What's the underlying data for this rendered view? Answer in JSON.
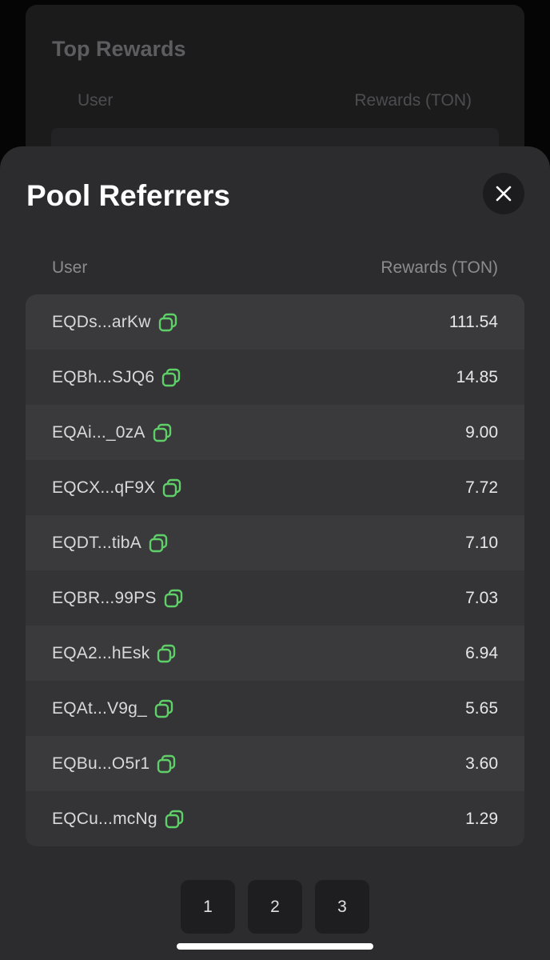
{
  "background": {
    "title": "Top Rewards",
    "col_user": "User",
    "col_rewards": "Rewards (TON)"
  },
  "sheet": {
    "title": "Pool Referrers",
    "close_icon": "close-icon",
    "col_user": "User",
    "col_rewards": "Rewards (TON)",
    "accent_color": "#5fd068",
    "rows": [
      {
        "address": "EQDs...arKw",
        "reward": "111.54"
      },
      {
        "address": "EQBh...SJQ6",
        "reward": "14.85"
      },
      {
        "address": "EQAi..._0zA",
        "reward": "9.00"
      },
      {
        "address": "EQCX...qF9X",
        "reward": "7.72"
      },
      {
        "address": "EQDT...tibA",
        "reward": "7.10"
      },
      {
        "address": "EQBR...99PS",
        "reward": "7.03"
      },
      {
        "address": "EQA2...hEsk",
        "reward": "6.94"
      },
      {
        "address": "EQAt...V9g_",
        "reward": "5.65"
      },
      {
        "address": "EQBu...O5r1",
        "reward": "3.60"
      },
      {
        "address": "EQCu...mcNg",
        "reward": "1.29"
      }
    ],
    "pages": [
      "1",
      "2",
      "3"
    ]
  }
}
